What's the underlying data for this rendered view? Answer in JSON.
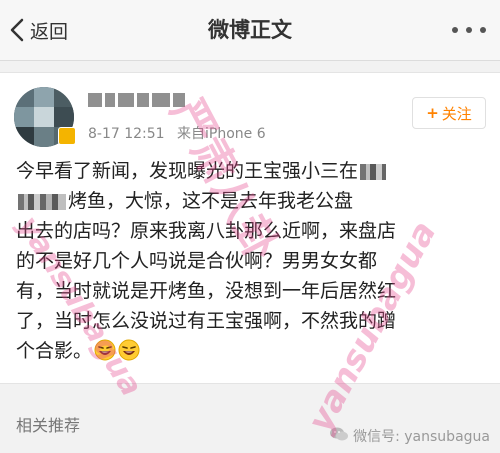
{
  "navbar": {
    "back_label": "返回",
    "title": "微博正文"
  },
  "post": {
    "time": "8-17 12:51",
    "source": "来自iPhone 6",
    "follow_label": "关注",
    "text": {
      "line1_a": "今早看了新闻，发现曝光的王宝强小三在",
      "line2_b": "烤鱼，大惊，这不是去年我老公盘",
      "line3": "出去的店吗？原来我离八卦那么近啊，来盘店",
      "line4": "的不是好几个人吗说是合伙啊？男男女女都",
      "line5": "有，当时就说是开烤鱼，没想到一年后居然红",
      "line6": "了，当时怎么没说过有王宝强啊，不然我的蹭",
      "line7": "个合影。"
    }
  },
  "watermarks": {
    "big": "严肃八卦",
    "script1": "yansubagua",
    "script2": "yansubagua"
  },
  "related": {
    "title": "相关推荐",
    "wechat": "微信号: yansubagua"
  },
  "colors": {
    "accent": "#ff8200",
    "watermark": "#e6468c"
  }
}
